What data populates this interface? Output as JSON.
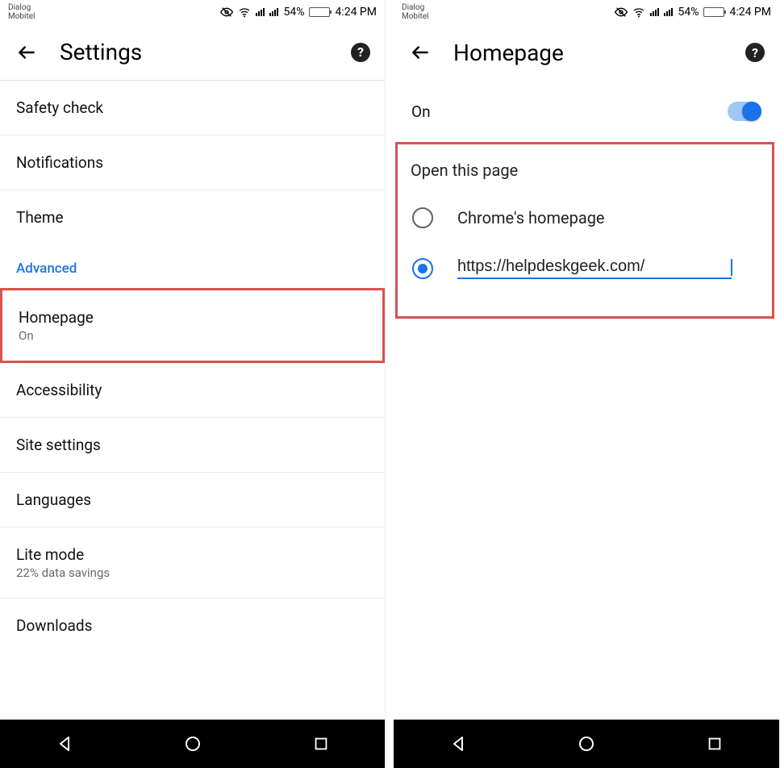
{
  "status": {
    "carrier_line1": "Dialog",
    "carrier_line2": "Mobitel",
    "battery_pct": "54%",
    "time": "4:24 PM"
  },
  "left": {
    "title": "Settings",
    "items": {
      "safety": "Safety check",
      "notifications": "Notifications",
      "theme": "Theme",
      "section": "Advanced",
      "homepage": "Homepage",
      "homepage_sub": "On",
      "accessibility": "Accessibility",
      "site": "Site settings",
      "languages": "Languages",
      "lite": "Lite mode",
      "lite_sub": "22% data savings",
      "downloads": "Downloads"
    }
  },
  "right": {
    "title": "Homepage",
    "toggle_label": "On",
    "group_title": "Open this page",
    "option_chrome": "Chrome's homepage",
    "url_value": "https://helpdeskgeek.com/"
  }
}
